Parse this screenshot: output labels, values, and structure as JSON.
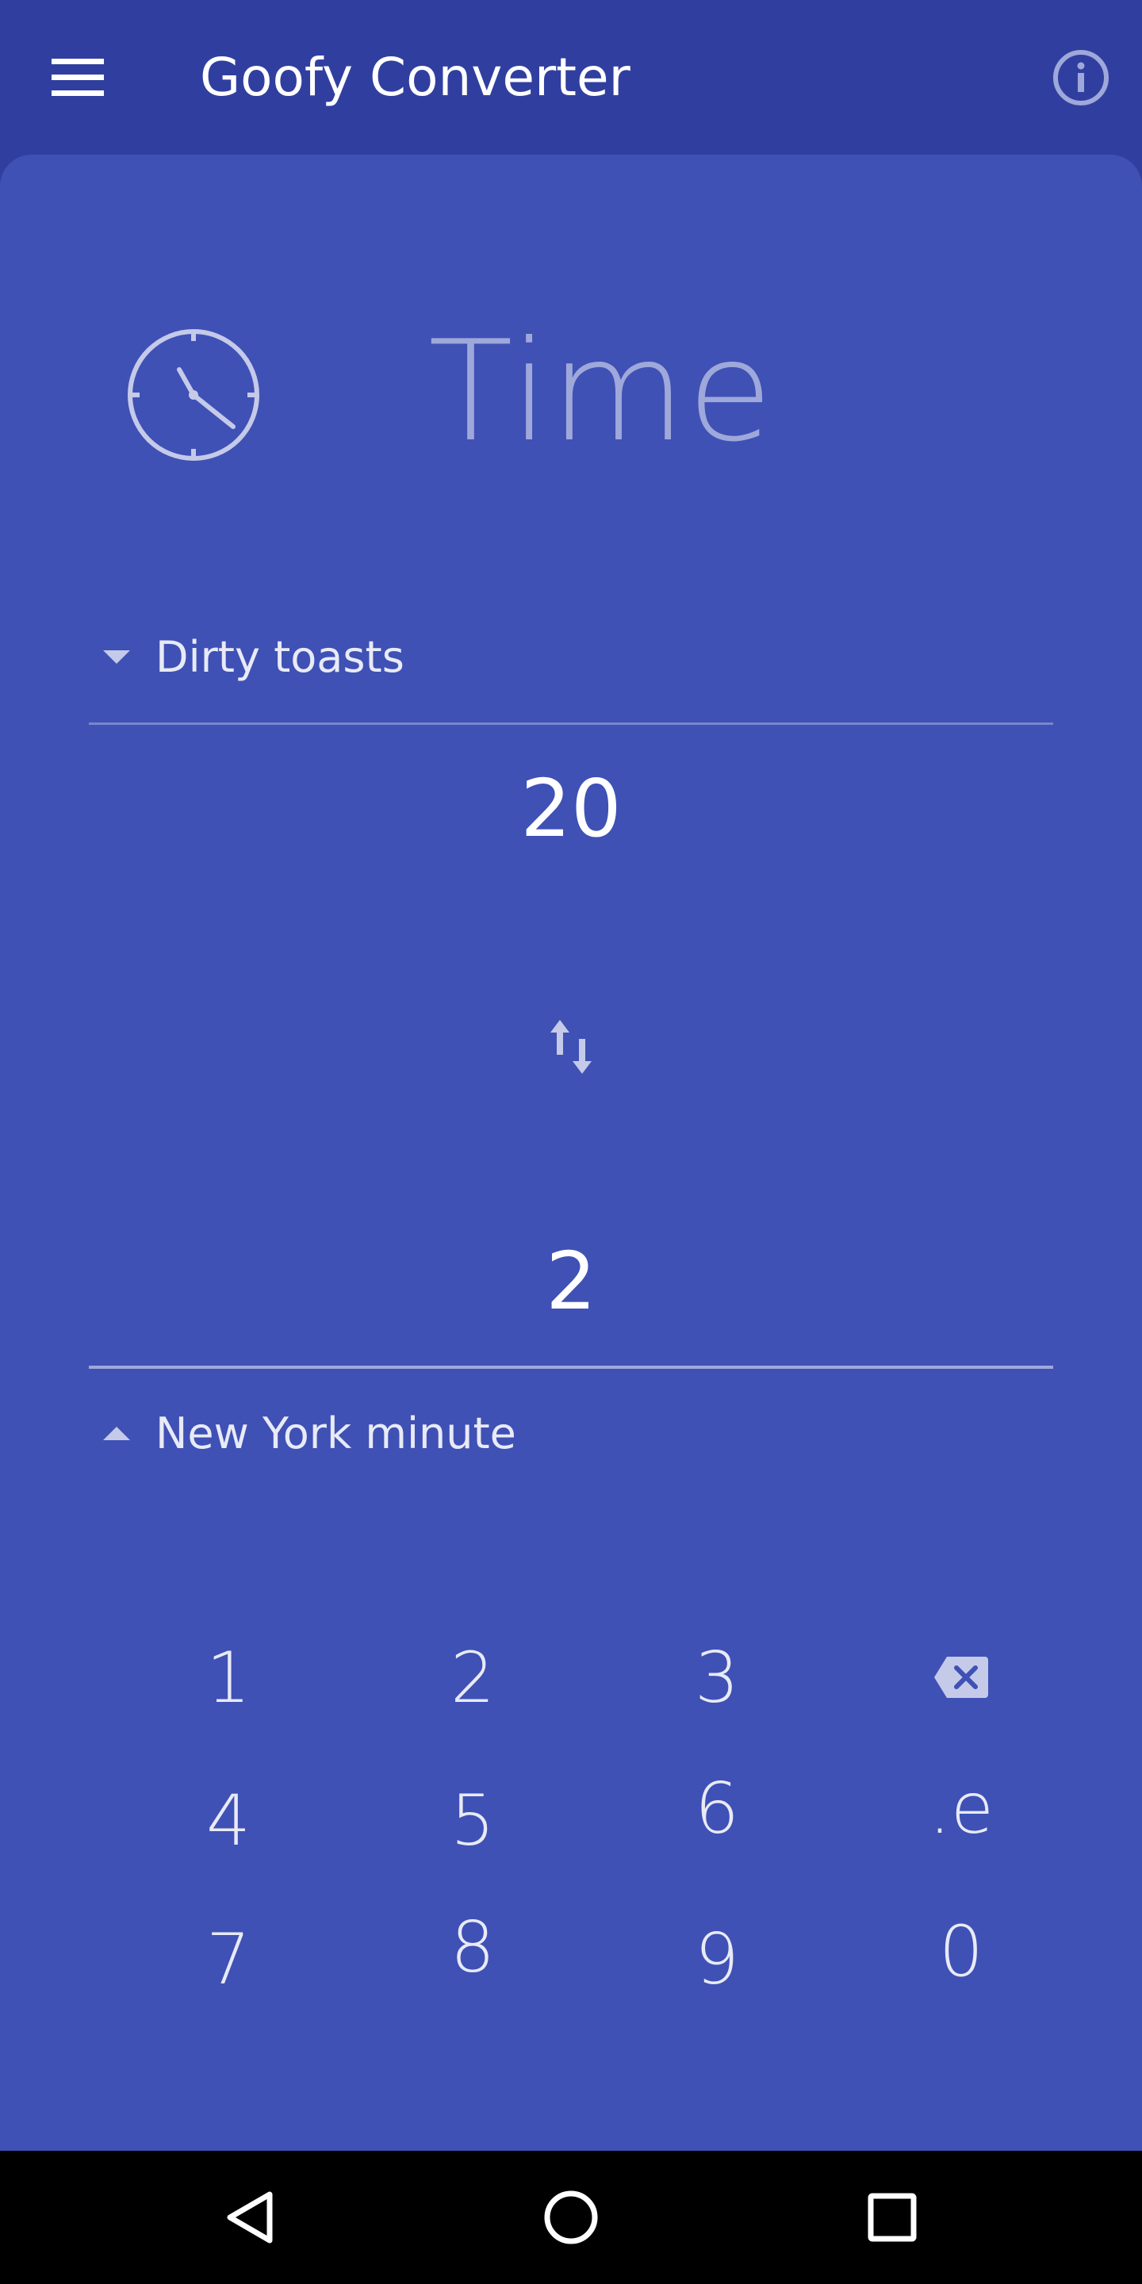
{
  "app": {
    "title": "Goofy Converter"
  },
  "colors": {
    "primary": "#3F51B5",
    "primary_dark": "#303F9F",
    "accent_light": "#9FA8DA",
    "text": "#FFFFFF"
  },
  "toolbar": {
    "menu_icon": "menu-icon",
    "info_icon": "info-icon"
  },
  "category": {
    "icon": "clock-icon",
    "title": "Time"
  },
  "converter": {
    "from_unit": "Dirty toasts",
    "from_value": "20",
    "swap_icon": "swap-vertical-icon",
    "to_value": "2",
    "to_unit": "New York minute"
  },
  "keypad": {
    "keys": [
      "1",
      "2",
      "3",
      "backspace",
      "4",
      "5",
      "6",
      ".e",
      "7",
      "8",
      "9",
      "0"
    ]
  },
  "navbar": {
    "back_icon": "back-triangle-icon",
    "home_icon": "home-circle-icon",
    "recents_icon": "recents-square-icon"
  }
}
